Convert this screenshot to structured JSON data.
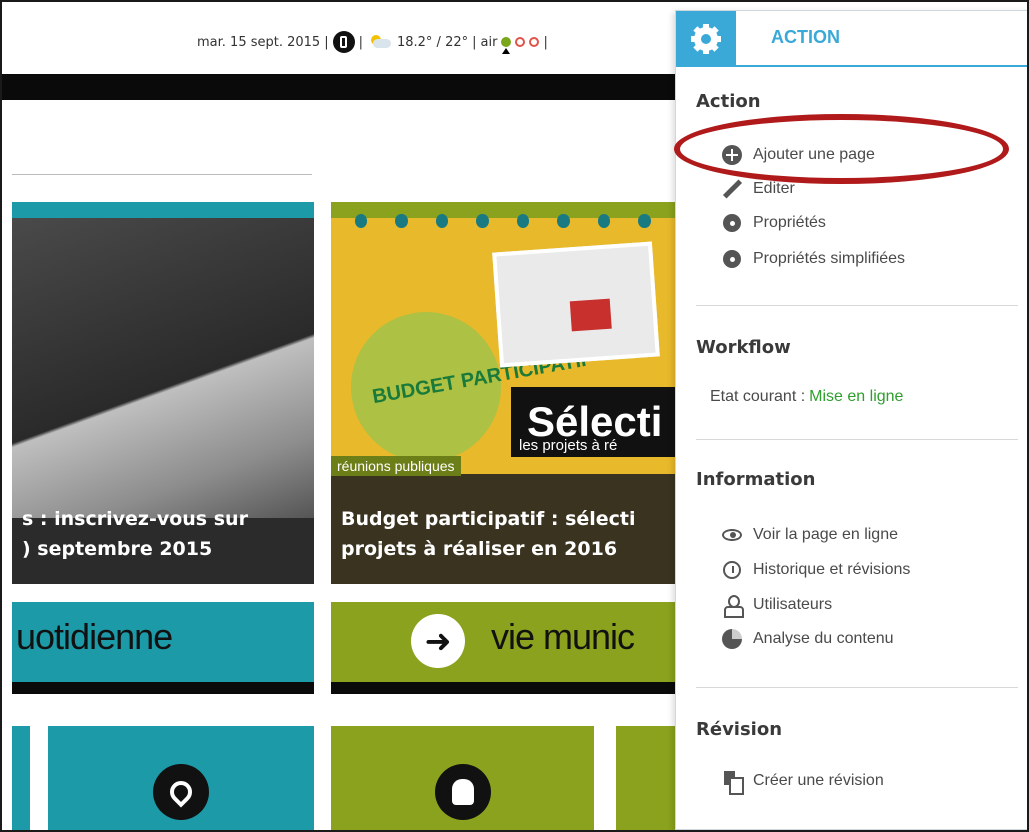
{
  "topbar": {
    "date": "mar. 15 sept. 2015",
    "separator": "|",
    "temperature": "18.2° / 22°",
    "air_label": "air"
  },
  "tiles": {
    "card1_caption_line1": "s : inscrivez-vous sur",
    "card1_caption_line2": ") septembre 2015",
    "card2_tag": "réunions publiques",
    "card2_caption_line1": "Budget participatif : sélecti",
    "card2_caption_line2": "projets à réaliser en 2016",
    "card2_badge": "BUDGET PARTICIPATIF",
    "card2_bubble": "Sélecti",
    "card2_bubble_sub": "les projets à ré",
    "tile_a_text": "uotidienne",
    "tile_b_text": "vie munic",
    "arrow": "➜"
  },
  "panel": {
    "title": "ACTION",
    "sections": {
      "action": {
        "title": "Action",
        "items": [
          "Ajouter une page",
          "Editer",
          "Propriétés",
          "Propriétés simplifiées"
        ]
      },
      "workflow": {
        "title": "Workflow",
        "status_label": "Etat courant :",
        "status_value": "Mise en ligne"
      },
      "information": {
        "title": "Information",
        "items": [
          "Voir la page en ligne",
          "Historique et révisions",
          "Utilisateurs",
          "Analyse du contenu"
        ]
      },
      "revision": {
        "title": "Révision",
        "items": [
          "Créer une révision"
        ]
      }
    },
    "status_color": "#2e9e2e",
    "accent_color": "#3aa9d7"
  },
  "highlight_color": "#b01a1a"
}
